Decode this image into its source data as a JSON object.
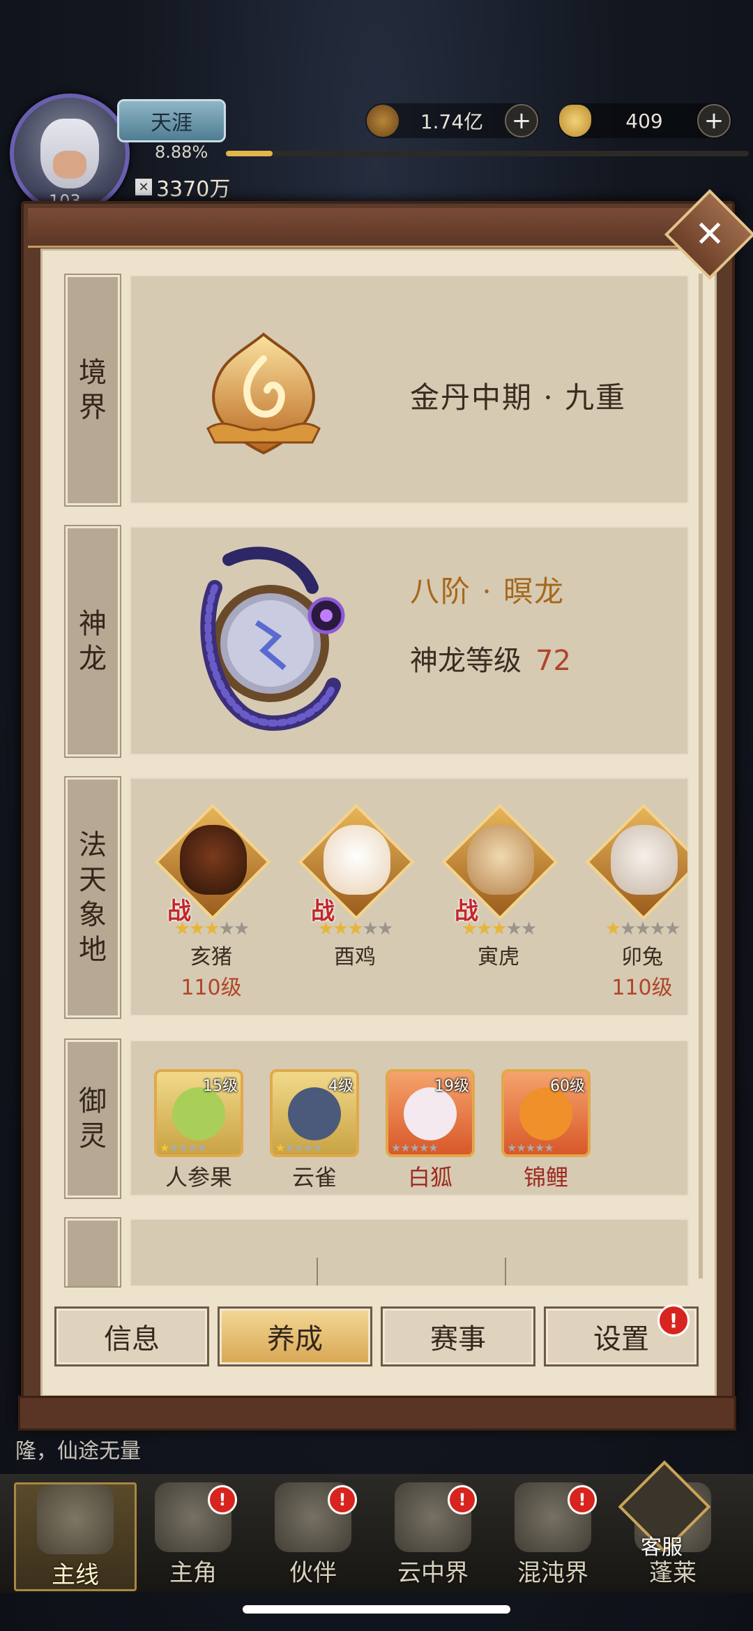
{
  "player": {
    "name": "天涯",
    "level": "103",
    "exp_percent": "8.88%",
    "power": "3370万"
  },
  "currency": {
    "coins": "1.74亿",
    "ingots": "409",
    "add_symbol": "+"
  },
  "panel": {
    "close_symbol": "✕",
    "realm": {
      "label": [
        "境",
        "界"
      ],
      "value": "金丹中期 · 九重"
    },
    "dragon": {
      "label": [
        "神",
        "龙"
      ],
      "title": "八阶 · 暝龙",
      "level_label": "神龙等级",
      "level_value": "72"
    },
    "dharma": {
      "label": [
        "法",
        "天",
        "象",
        "地"
      ],
      "war_tag": "战",
      "beasts": [
        {
          "name": "亥猪",
          "stars": 3,
          "level": "110级",
          "war": true
        },
        {
          "name": "酉鸡",
          "stars": 3,
          "level": "",
          "war": true
        },
        {
          "name": "寅虎",
          "stars": 3,
          "level": "",
          "war": true
        },
        {
          "name": "卯兔",
          "stars": 1,
          "level": "110级",
          "war": false
        }
      ]
    },
    "spirits": {
      "label": [
        "御",
        "灵"
      ],
      "items": [
        {
          "name": "人参果",
          "level": "15级",
          "stars": 1,
          "name_color": "#3a2c1f"
        },
        {
          "name": "云雀",
          "level": "4级",
          "stars": 1,
          "name_color": "#3a2c1f"
        },
        {
          "name": "白狐",
          "level": "19级",
          "stars": 0,
          "name_color": "#9e2a20"
        },
        {
          "name": "锦鲤",
          "level": "60级",
          "stars": 0,
          "name_color": "#9e2a20"
        }
      ]
    },
    "tabs": [
      {
        "label": "信息",
        "active": false,
        "badge": ""
      },
      {
        "label": "养成",
        "active": true,
        "badge": ""
      },
      {
        "label": "赛事",
        "active": false,
        "badge": ""
      },
      {
        "label": "设置",
        "active": false,
        "badge": "!"
      }
    ]
  },
  "chat": {
    "text": "隆，仙途无量"
  },
  "nav": {
    "items": [
      {
        "label": "主线",
        "active": true,
        "badge": ""
      },
      {
        "label": "主角",
        "active": false,
        "badge": "!"
      },
      {
        "label": "伙伴",
        "active": false,
        "badge": "!"
      },
      {
        "label": "云中界",
        "active": false,
        "badge": "!"
      },
      {
        "label": "混沌界",
        "active": false,
        "badge": "!"
      },
      {
        "label": "蓬莱",
        "active": false,
        "badge": ""
      }
    ],
    "customer_service": "客服"
  },
  "colors": {
    "accent_gold": "#e3b54a",
    "level_red": "#b04528",
    "badge_red": "#d8241f"
  }
}
